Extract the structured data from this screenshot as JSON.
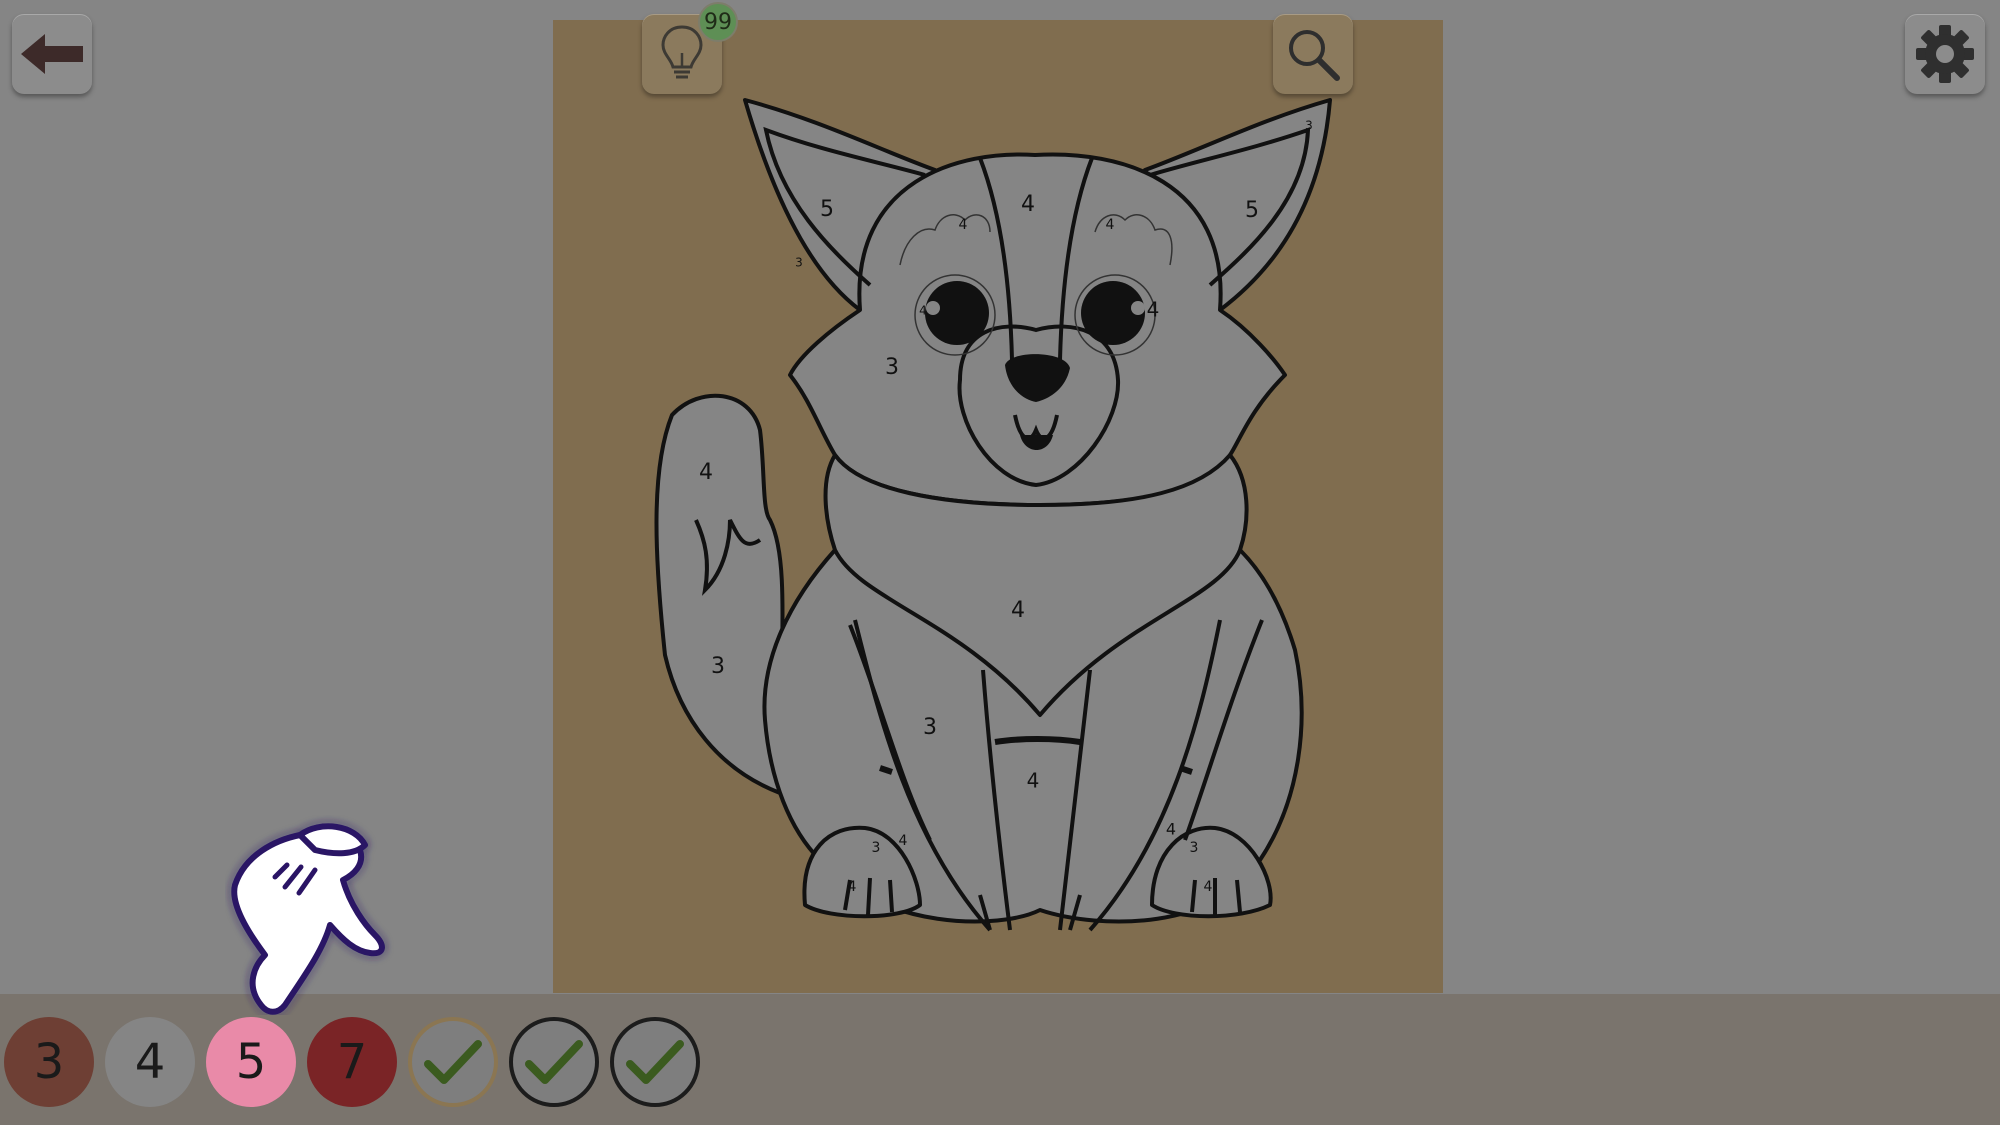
{
  "hints": {
    "count": "99"
  },
  "icons": {
    "back": "back-arrow-icon",
    "hint": "lightbulb-icon",
    "zoom": "magnifier-icon",
    "settings": "gear-icon",
    "check": "checkmark-icon",
    "hand": "pointing-hand-icon"
  },
  "canvas": {
    "background": "#806d4f",
    "region_numbers": {
      "ear_left": "5",
      "ear_right": "5",
      "ear_left_edge": "3",
      "ear_right_tip": "3",
      "forehead_stripe": "4",
      "brow_left": "4",
      "brow_right": "4",
      "eye_left": "4",
      "eye_right": "4",
      "cheek": "3",
      "tail_tip": "4",
      "tail_base": "3",
      "chest": "4",
      "leg_left": "3",
      "belly": "4",
      "paw_left_a": "3",
      "paw_left_b": "4",
      "paw_left_c": "4",
      "paw_right_a": "4",
      "paw_right_b": "3",
      "paw_right_c": "4"
    }
  },
  "palette": {
    "colors": [
      {
        "number": "3",
        "color": "#6e3f34",
        "state": "available"
      },
      {
        "number": "4",
        "color": "#858585",
        "state": "available"
      },
      {
        "number": "5",
        "color": "#e98aa8",
        "state": "selected"
      },
      {
        "number": "7",
        "color": "#7a2426",
        "state": "available"
      },
      {
        "number": "",
        "color": "#7e7e7e",
        "state": "completed"
      },
      {
        "number": "",
        "color": "#7e7e7e",
        "state": "completed"
      },
      {
        "number": "",
        "color": "#7e7e7e",
        "state": "completed"
      }
    ]
  }
}
